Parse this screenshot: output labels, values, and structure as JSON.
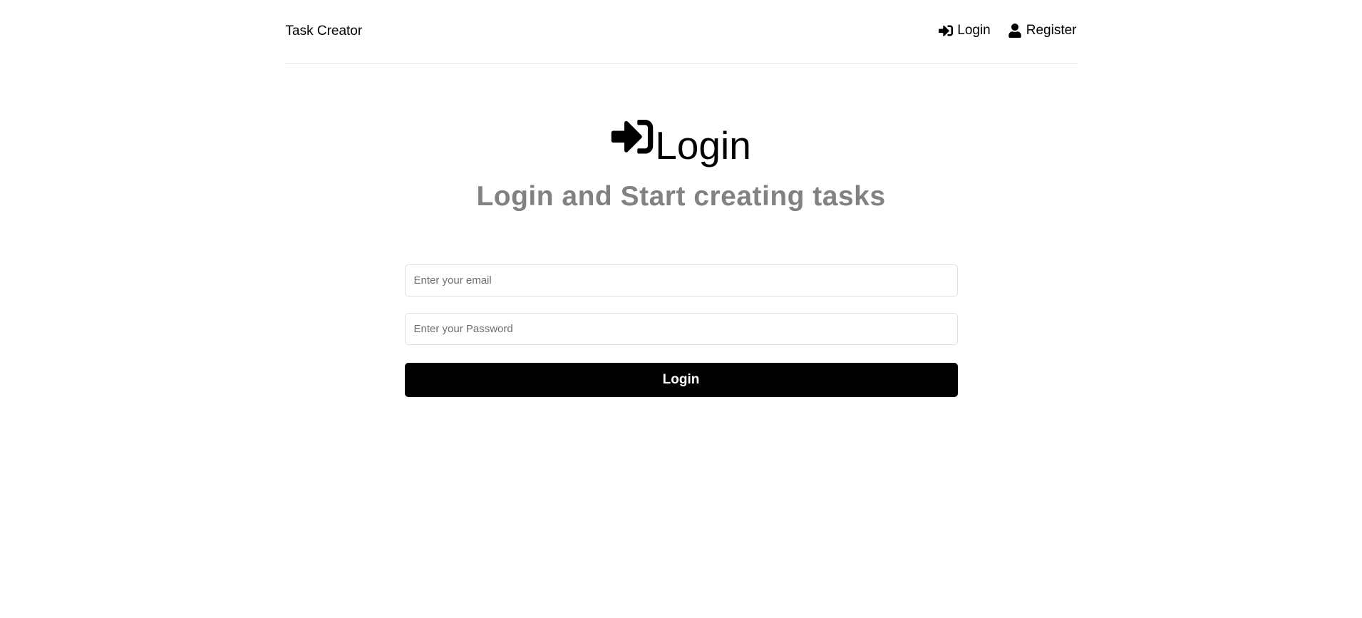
{
  "header": {
    "brand": "Task Creator",
    "nav": {
      "login_label": "Login",
      "login_icon": "sign-in-icon",
      "register_label": "Register",
      "register_icon": "user-icon"
    }
  },
  "main": {
    "heading": "Login",
    "heading_icon": "sign-in-icon",
    "subheading": "Login and Start creating tasks"
  },
  "form": {
    "email_placeholder": "Enter your email",
    "email_value": "",
    "password_placeholder": "Enter your Password",
    "password_value": "",
    "submit_label": "Login"
  },
  "colors": {
    "background": "#ffffff",
    "text": "#000000",
    "subheading": "#828282",
    "button_bg": "#000000",
    "button_text": "#ffffff",
    "border": "#e0e0e0"
  }
}
